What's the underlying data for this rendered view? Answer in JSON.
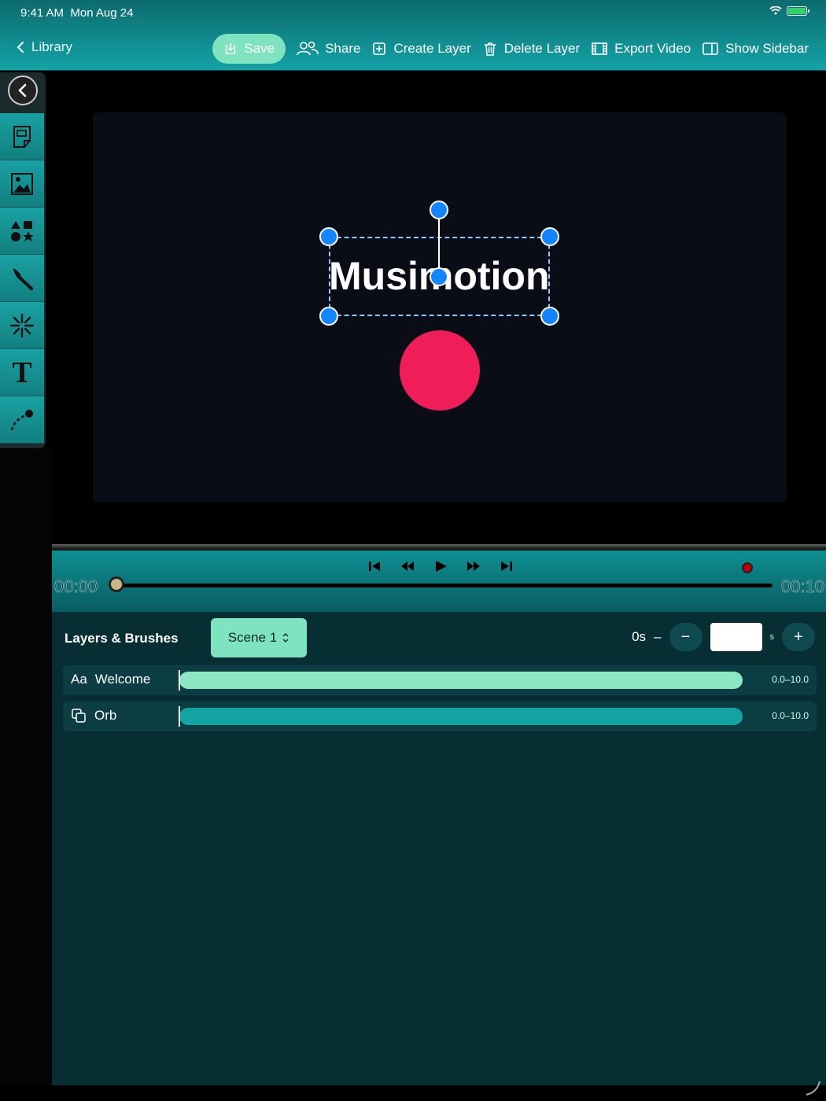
{
  "status": {
    "time": "9:41 AM",
    "date": "Mon Aug 24"
  },
  "nav": {
    "back_label": "Library",
    "save_label": "Save",
    "share_label": "Share",
    "create_layer_label": "Create Layer",
    "delete_layer_label": "Delete Layer",
    "export_label": "Export Video",
    "sidebar_label": "Show Sidebar"
  },
  "tools": [
    "document-tool-icon",
    "image-tool-icon",
    "shapes-tool-icon",
    "brush-tool-icon",
    "particles-tool-icon",
    "text-tool-icon",
    "path-tool-icon"
  ],
  "canvas": {
    "text": "Musimotion",
    "orb_color": "#f01e58"
  },
  "timeline": {
    "start": "00:00",
    "end": "00:10"
  },
  "layers": {
    "title": "Layers & Brushes",
    "scene": "Scene 1",
    "duration_label": "0s",
    "duration_unit": "s",
    "minus": "−",
    "plus": "+",
    "items": [
      {
        "icon": "Aa",
        "name": "Welcome",
        "range": "0.0–10.0",
        "color": "#8be8c2"
      },
      {
        "icon": "layers-icon",
        "name": "Orb",
        "range": "0.0–10.0",
        "color": "#13a3a3"
      }
    ]
  },
  "colors": {
    "accent": "#7fe3c0",
    "handle": "#1484ff",
    "teal": "#14a3a6"
  }
}
